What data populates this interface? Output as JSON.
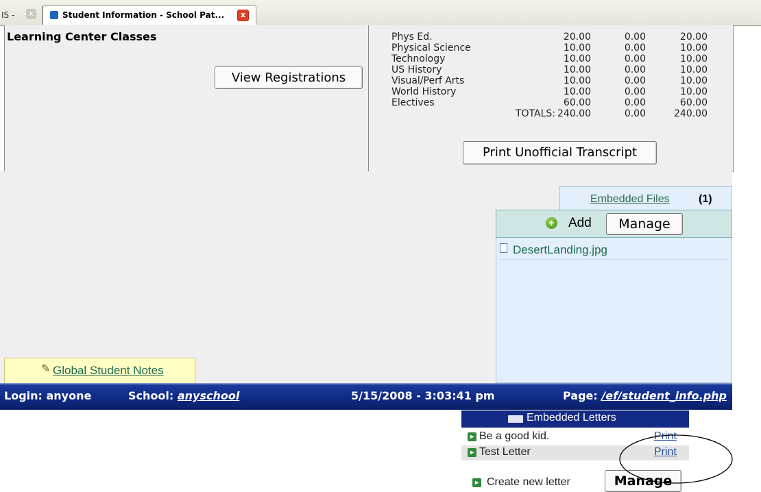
{
  "browser": {
    "prev_tab_label": "IS -",
    "active_tab_label": "Student Information - School Pat...",
    "close_glyph": "x"
  },
  "learning_center": {
    "title": "Learning Center Classes",
    "view_registrations_label": "View Registrations"
  },
  "credits": {
    "rows": [
      {
        "name": "Phys Ed.",
        "a": "20.00",
        "b": "0.00",
        "c": "20.00"
      },
      {
        "name": "Physical Science",
        "a": "10.00",
        "b": "0.00",
        "c": "10.00"
      },
      {
        "name": "Technology",
        "a": "10.00",
        "b": "0.00",
        "c": "10.00"
      },
      {
        "name": "US History",
        "a": "10.00",
        "b": "0.00",
        "c": "10.00"
      },
      {
        "name": "Visual/Perf Arts",
        "a": "10.00",
        "b": "0.00",
        "c": "10.00"
      },
      {
        "name": "World History",
        "a": "10.00",
        "b": "0.00",
        "c": "10.00"
      },
      {
        "name": "Electives",
        "a": "60.00",
        "b": "0.00",
        "c": "60.00"
      }
    ],
    "totals": {
      "label": "TOTALS:",
      "a": "240.00",
      "b": "0.00",
      "c": "240.00"
    },
    "print_transcript_label": "Print Unofficial Transcript"
  },
  "embedded_files": {
    "title": "Embedded Files",
    "count": "(1)",
    "add_label": "Add",
    "manage_label": "Manage",
    "files": [
      {
        "name": "DesertLanding.jpg"
      }
    ]
  },
  "notes": {
    "label": "Global Student Notes"
  },
  "status_bar": {
    "login_label": "Login: anyone",
    "school_label": "School:",
    "school_value": "anyschool",
    "datetime": "5/15/2008 - 3:03:41 pm",
    "page_label": "Page:",
    "page_value": "/ef/student_info.php"
  },
  "embedded_letters": {
    "title": "Embedded Letters",
    "letters": [
      {
        "name": "Be a good kid.",
        "print_label": "Print"
      },
      {
        "name": "Test Letter",
        "print_label": "Print"
      }
    ],
    "create_label": "Create new letter",
    "manage_label": "Manage"
  },
  "colors": {
    "status_bar": "#0f2a84",
    "embedded_files_bg": "#e3effc",
    "embedded_files_toolbar": "#cfe6e4",
    "notes_bg": "#ffffc4",
    "link_green": "#1f6a52",
    "link_blue": "#2b4fa0"
  },
  "icons": [
    "tab-favicon-icon",
    "tab-close-icon",
    "add-icon",
    "file-icon",
    "pencil-icon",
    "letter-icon",
    "arrow-right-icon"
  ]
}
